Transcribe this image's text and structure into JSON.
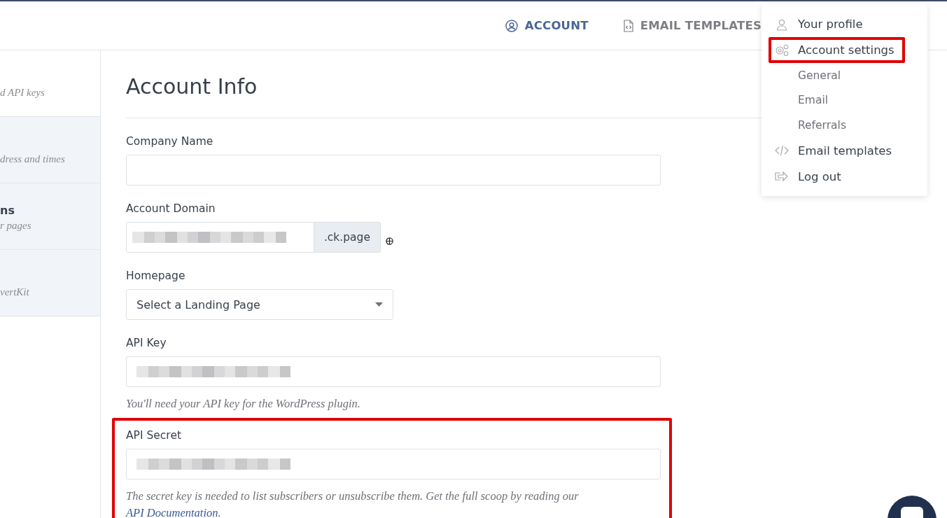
{
  "header": {
    "nav": [
      {
        "label": "ACCOUNT",
        "selected": true
      },
      {
        "label": "EMAIL TEMPLATES",
        "selected": false
      }
    ]
  },
  "sidebar": {
    "items": [
      {
        "subtitle": "d API keys",
        "selected": true
      },
      {
        "subtitle": "dress and times",
        "selected": false
      },
      {
        "title": "ns",
        "subtitle": "r pages",
        "selected": false
      },
      {
        "subtitle": "vertKit",
        "selected": false
      }
    ]
  },
  "main": {
    "title": "Account Info",
    "fields": [
      {
        "kind": "text",
        "label": "Company Name",
        "value_redacted": false,
        "highlighted": false
      },
      {
        "kind": "addon",
        "label": "Account Domain",
        "value_redacted": true,
        "addon": ".ck.page",
        "highlighted": false
      },
      {
        "kind": "select",
        "label": "Homepage",
        "value": "Select a Landing Page",
        "highlighted": false
      },
      {
        "kind": "text",
        "label": "API Key",
        "value_redacted": true,
        "help": "You'll need your API key for the WordPress plugin.",
        "highlighted": false
      },
      {
        "kind": "text",
        "label": "API Secret",
        "value_redacted": true,
        "help": "The secret key is needed to list subscribers or unsubscribe them. Get the full scoop by reading our ",
        "link": "API Documentation",
        "help_end": ".",
        "highlighted": true
      }
    ]
  },
  "menu": {
    "items": [
      {
        "kind": "main",
        "label": "Your profile",
        "highlighted": false
      },
      {
        "kind": "main",
        "label": "Account settings",
        "highlighted": true
      },
      {
        "kind": "sub",
        "label": "General"
      },
      {
        "kind": "sub",
        "label": "Email"
      },
      {
        "kind": "sub",
        "label": "Referrals"
      },
      {
        "kind": "main",
        "label": "Email templates",
        "highlighted": false
      },
      {
        "kind": "main",
        "label": "Log out",
        "highlighted": false
      }
    ]
  }
}
